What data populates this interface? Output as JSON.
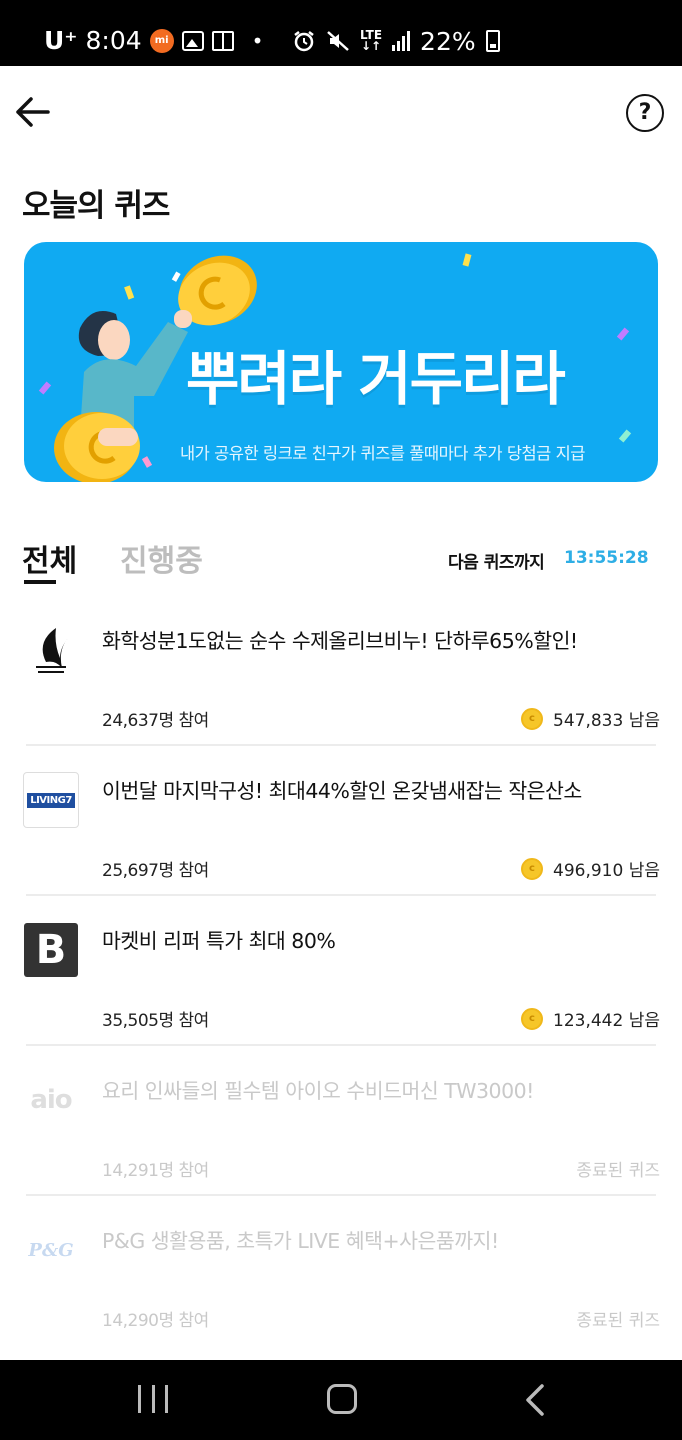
{
  "status_bar": {
    "carrier": "U⁺",
    "time": "8:04",
    "mi_label": "mi",
    "lte": "LTE",
    "battery": "22%"
  },
  "header": {
    "help_label": "?"
  },
  "page_title": "오늘의 퀴즈",
  "banner": {
    "title": "뿌려라 거두리라",
    "subtitle": "내가 공유한 링크로 친구가 퀴즈를 풀때마다 추가 당첨금 지급",
    "background_color": "#10aaf2"
  },
  "tabs": {
    "all": "전체",
    "ongoing": "진행중",
    "next_label": "다음 퀴즈까지",
    "next_time": "13:55:28"
  },
  "quizzes": [
    {
      "title": "화학성분1도없는 순수 수제올리브비누! 단하루65%할인!",
      "participants": "24,637명 참여",
      "remaining": "547,833 남음",
      "logo": "feather-logo",
      "ended": false
    },
    {
      "title": "이번달 마지막구성! 최대44%할인 온갖냄새잡는 작은산소",
      "participants": "25,697명 참여",
      "remaining": "496,910 남음",
      "logo": "LIVING7",
      "ended": false
    },
    {
      "title": "마켓비 리퍼 특가 최대 80%",
      "participants": "35,505명 참여",
      "remaining": "123,442 남음",
      "logo": "B",
      "ended": false
    },
    {
      "title": "요리 인싸들의 필수템 아이오 수비드머신 TW3000!",
      "participants": "14,291명 참여",
      "status": "종료된 퀴즈",
      "logo": "aio",
      "ended": true
    },
    {
      "title": "P&G 생활용품, 초특가 LIVE 혜택+사은품까지!",
      "participants": "14,290명 참여",
      "status": "종료된 퀴즈",
      "logo": "P&G",
      "ended": true
    }
  ],
  "coin_symbol": "c"
}
